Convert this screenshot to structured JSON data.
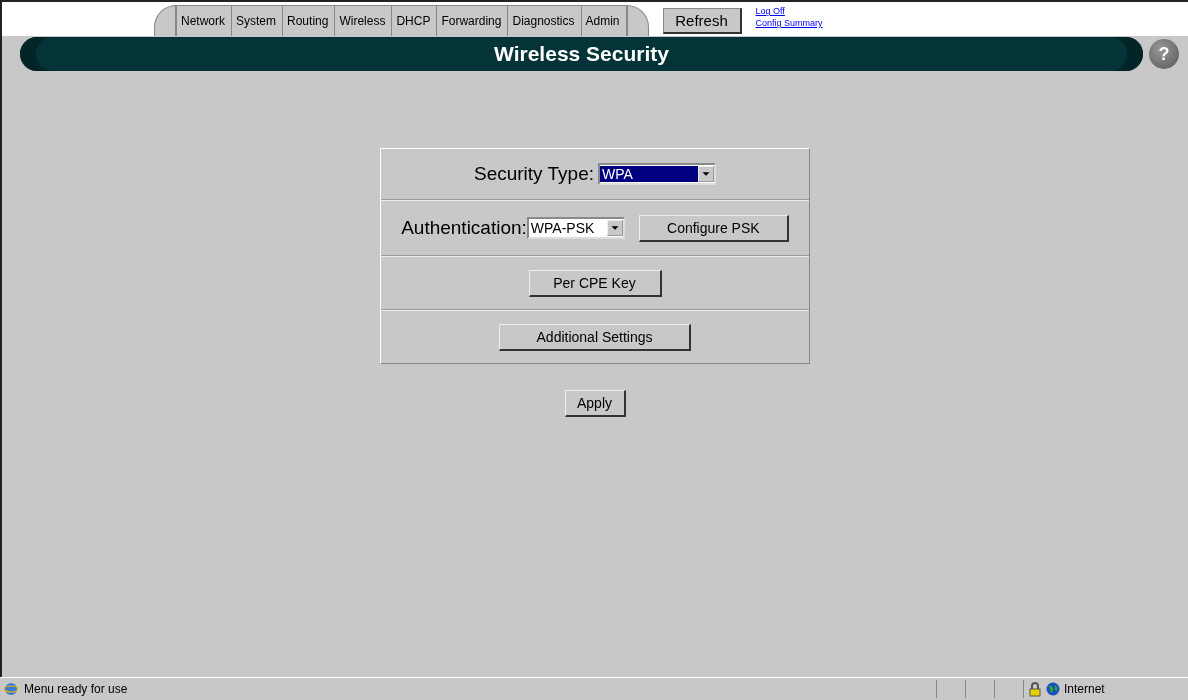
{
  "tabs": [
    {
      "label": "Network",
      "selected": false
    },
    {
      "label": "System",
      "selected": false
    },
    {
      "label": "Routing",
      "selected": false
    },
    {
      "label": "Wireless",
      "selected": false
    },
    {
      "label": "DHCP",
      "selected": false
    },
    {
      "label": "Forwarding",
      "selected": false
    },
    {
      "label": "Diagnostics",
      "selected": false
    },
    {
      "label": "Admin",
      "selected": false
    }
  ],
  "refresh_button": "Refresh",
  "links": [
    "Log Off",
    "Config Summary"
  ],
  "page_title": "Wireless Security",
  "help_button": "?",
  "security_type": {
    "label": "Security Type:",
    "value": "WPA"
  },
  "authentication": {
    "label": "Authentication:",
    "value": "WPA-PSK",
    "button": "Configure PSK"
  },
  "per_cpe_button": "Per CPE Key",
  "additional_button": "Additional Settings",
  "apply_button": "Apply",
  "status_bar": {
    "text": "Menu ready for use",
    "zone": "Internet"
  }
}
